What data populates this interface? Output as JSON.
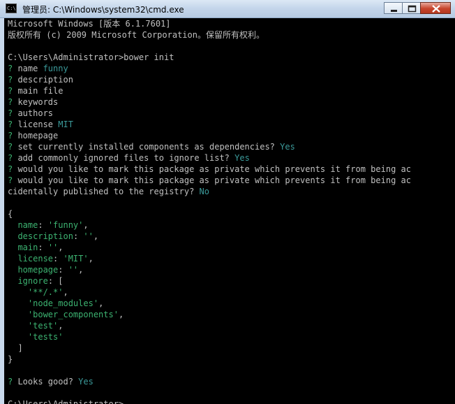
{
  "titlebar": {
    "app_icon_text": "C:\\",
    "title": "管理员: C:\\Windows\\system32\\cmd.exe"
  },
  "console": {
    "lines": [
      {
        "prefix": "",
        "text": "Microsoft Windows [版本 6.1.7601]",
        "answer": ""
      },
      {
        "prefix": "",
        "text": "版权所有 (c) 2009 Microsoft Corporation。保留所有权利。",
        "answer": ""
      },
      {
        "prefix": "",
        "text": "",
        "answer": ""
      },
      {
        "prefix": "",
        "text": "C:\\Users\\Administrator>bower init",
        "answer": ""
      },
      {
        "prefix": "? ",
        "text": "name ",
        "answer": "funny"
      },
      {
        "prefix": "? ",
        "text": "description",
        "answer": ""
      },
      {
        "prefix": "? ",
        "text": "main file",
        "answer": ""
      },
      {
        "prefix": "? ",
        "text": "keywords",
        "answer": ""
      },
      {
        "prefix": "? ",
        "text": "authors",
        "answer": ""
      },
      {
        "prefix": "? ",
        "text": "license ",
        "answer": "MIT"
      },
      {
        "prefix": "? ",
        "text": "homepage",
        "answer": ""
      },
      {
        "prefix": "? ",
        "text": "set currently installed components as dependencies? ",
        "answer": "Yes"
      },
      {
        "prefix": "? ",
        "text": "add commonly ignored files to ignore list? ",
        "answer": "Yes"
      },
      {
        "prefix": "? ",
        "text": "would you like to mark this package as private which prevents it from being ac",
        "answer": ""
      },
      {
        "prefix": "? ",
        "text": "would you like to mark this package as private which prevents it from being ac",
        "answer": ""
      },
      {
        "prefix": "",
        "text": "cidentally published to the registry? ",
        "answer": "No"
      },
      {
        "prefix": "",
        "text": "",
        "answer": ""
      },
      {
        "prefix": "",
        "text": "{",
        "answer": ""
      },
      {
        "prefix": "",
        "text": "  ",
        "key": "name",
        "rest": ": ",
        "value": "'funny'",
        "tail": ","
      },
      {
        "prefix": "",
        "text": "  ",
        "key": "description",
        "rest": ": ",
        "value": "''",
        "tail": ","
      },
      {
        "prefix": "",
        "text": "  ",
        "key": "main",
        "rest": ": ",
        "value": "''",
        "tail": ","
      },
      {
        "prefix": "",
        "text": "  ",
        "key": "license",
        "rest": ": ",
        "value": "'MIT'",
        "tail": ","
      },
      {
        "prefix": "",
        "text": "  ",
        "key": "homepage",
        "rest": ": ",
        "value": "''",
        "tail": ","
      },
      {
        "prefix": "",
        "text": "  ",
        "key": "ignore",
        "rest": ": [",
        "value": "",
        "tail": ""
      },
      {
        "prefix": "",
        "text": "    ",
        "key": "",
        "rest": "",
        "value": "'**/.*'",
        "tail": ","
      },
      {
        "prefix": "",
        "text": "    ",
        "key": "",
        "rest": "",
        "value": "'node_modules'",
        "tail": ","
      },
      {
        "prefix": "",
        "text": "    ",
        "key": "",
        "rest": "",
        "value": "'bower_components'",
        "tail": ","
      },
      {
        "prefix": "",
        "text": "    ",
        "key": "",
        "rest": "",
        "value": "'test'",
        "tail": ","
      },
      {
        "prefix": "",
        "text": "    ",
        "key": "",
        "rest": "",
        "value": "'tests'",
        "tail": ""
      },
      {
        "prefix": "",
        "text": "  ]",
        "answer": ""
      },
      {
        "prefix": "",
        "text": "}",
        "answer": ""
      },
      {
        "prefix": "",
        "text": "",
        "answer": ""
      },
      {
        "prefix": "? ",
        "text": "Looks good? ",
        "answer": "Yes"
      },
      {
        "prefix": "",
        "text": "",
        "answer": ""
      },
      {
        "prefix": "",
        "text": "C:\\Users\\Administrator>",
        "answer": ""
      }
    ]
  },
  "colors": {
    "console_bg": "#000000",
    "console_fg": "#c0c0c0",
    "prompt_green": "#3cb371",
    "answer_cyan": "#3b9a9a"
  }
}
